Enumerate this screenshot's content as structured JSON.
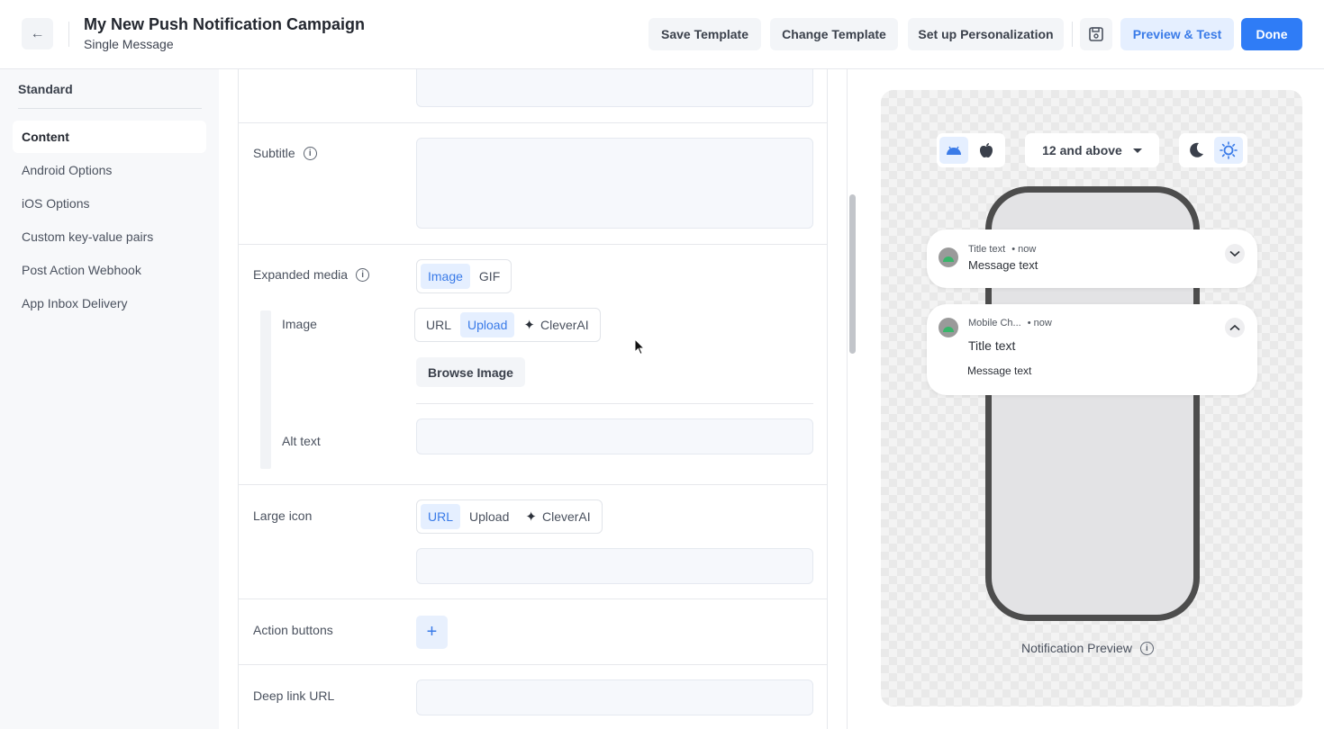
{
  "header": {
    "title": "My New Push Notification Campaign",
    "subtitle": "Single Message",
    "save_template": "Save Template",
    "change_template": "Change Template",
    "setup_personalization": "Set up Personalization",
    "preview_test": "Preview & Test",
    "done": "Done"
  },
  "sidebar": {
    "heading": "Standard",
    "items": [
      {
        "label": "Content",
        "active": true
      },
      {
        "label": "Android Options"
      },
      {
        "label": "iOS Options"
      },
      {
        "label": "Custom key-value pairs"
      },
      {
        "label": "Post Action Webhook"
      },
      {
        "label": "App Inbox Delivery"
      }
    ]
  },
  "form": {
    "subtitle_label": "Subtitle",
    "expanded_media_label": "Expanded media",
    "media_types": [
      "Image",
      "GIF"
    ],
    "media_selected": "Image",
    "image_label": "Image",
    "image_sources": [
      "URL",
      "Upload",
      "CleverAI"
    ],
    "image_source_selected": "Upload",
    "browse_image": "Browse Image",
    "alt_text_label": "Alt text",
    "large_icon_label": "Large icon",
    "large_icon_sources": [
      "URL",
      "Upload",
      "CleverAI"
    ],
    "large_icon_source_selected": "URL",
    "action_buttons_label": "Action buttons",
    "deep_link_label": "Deep link URL"
  },
  "preview": {
    "os_options": [
      "android-icon",
      "apple-icon"
    ],
    "os_selected": "android",
    "version": "12 and above",
    "theme_options": [
      "moon-icon",
      "sun-icon"
    ],
    "theme_selected": "light",
    "collapsed": {
      "title": "Title text",
      "time": "• now",
      "message": "Message text"
    },
    "expanded": {
      "app": "Mobile Ch...",
      "time": "• now",
      "title": "Title text",
      "message": "Message text"
    },
    "label": "Notification Preview"
  },
  "colors": {
    "accent": "#2f7cf6",
    "accent_light": "#e5efff",
    "sidebar_bg": "#f7f8fa"
  }
}
